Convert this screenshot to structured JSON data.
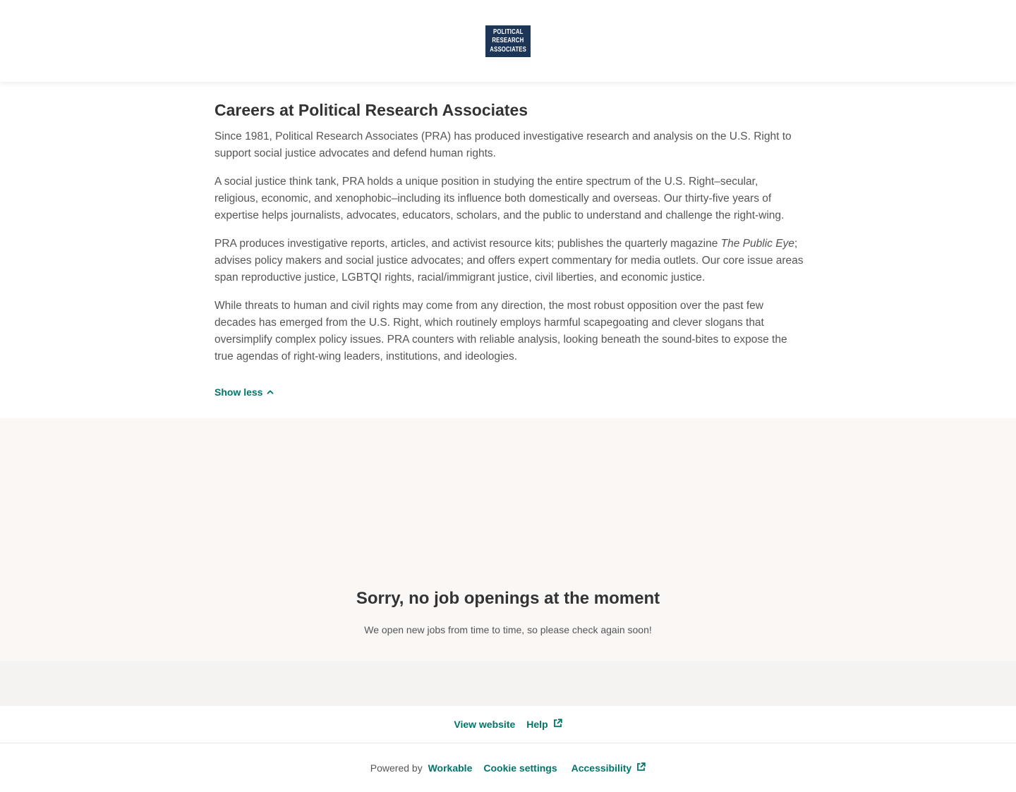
{
  "header": {
    "logo_lines": [
      "POLITICAL",
      "RESEARCH",
      "ASSOCIATES"
    ],
    "logo_color": "#1d3557"
  },
  "about": {
    "title": "Careers at Political Research Associates",
    "paragraph_1": "Since 1981, Political Research Associates (PRA) has produced investigative research and analysis on the U.S. Right to support social justice advocates and defend human rights.",
    "paragraph_2": "A social justice think tank, PRA holds a unique position in studying the entire spectrum of the U.S. Right–secular, religious, economic, and xenophobic–including its influence both domestically and overseas. Our thirty-five years of expertise helps journalists, advocates, educators, scholars, and the public to understand and challenge the right-wing.",
    "paragraph_3_before": "PRA produces investigative reports, articles, and activist resource kits; publishes the quarterly magazine ",
    "paragraph_3_italic": "The Public Eye",
    "paragraph_3_after": "; advises policy makers and social justice advocates; and offers expert commentary for media outlets. Our core issue areas span reproductive justice, LGBTQI rights, racial/immigrant justice, civil liberties, and economic justice.",
    "paragraph_4": "While threats to human and civil rights may come from any direction, the most robust opposition over the past few decades has emerged from the U.S. Right, which routinely employs harmful scapegoating and clever slogans that oversimplify complex policy issues. PRA counters with reliable analysis, looking beneath the sound-bites to expose the true agendas of right-wing leaders, institutions, and ideologies.",
    "show_less_label": "Show less",
    "show_less_icon": "chevron-up-icon"
  },
  "jobs": {
    "empty_title": "Sorry, no job openings at the moment",
    "empty_subtitle": "We open new jobs from time to time, so please check again soon!"
  },
  "footer": {
    "view_website_label": "View website",
    "help_label": "Help",
    "powered_by_text": "Powered by",
    "powered_by_brand": "Workable",
    "cookie_settings_label": "Cookie settings",
    "accessibility_label": "Accessibility",
    "external_icon": "external-link-icon"
  },
  "colors": {
    "accent": "#00756a",
    "jobs_background": "#faf7f5",
    "band_background": "#f4f3f2"
  }
}
